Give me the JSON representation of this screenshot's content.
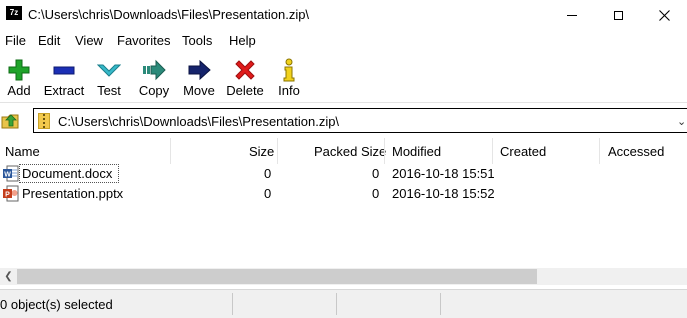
{
  "window": {
    "app_icon_text": "7z",
    "title": "C:\\Users\\chris\\Downloads\\Files\\Presentation.zip\\"
  },
  "menu": [
    "File",
    "Edit",
    "View",
    "Favorites",
    "Tools",
    "Help"
  ],
  "toolbar": {
    "add": "Add",
    "extract": "Extract",
    "test": "Test",
    "copy": "Copy",
    "move": "Move",
    "delete": "Delete",
    "info": "Info"
  },
  "address": {
    "path": "C:\\Users\\chris\\Downloads\\Files\\Presentation.zip\\"
  },
  "columns": {
    "name": "Name",
    "size": "Size",
    "packed_size": "Packed Size",
    "modified": "Modified",
    "created": "Created",
    "accessed": "Accessed"
  },
  "files": [
    {
      "name": "Document.docx",
      "size": "0",
      "packed_size": "0",
      "modified": "2016-10-18 15:51",
      "icon": "word-doc-icon"
    },
    {
      "name": "Presentation.pptx",
      "size": "0",
      "packed_size": "0",
      "modified": "2016-10-18 15:52",
      "icon": "powerpoint-icon"
    }
  ],
  "status": {
    "selected": "0 object(s) selected"
  },
  "colors": {
    "add_green": "#1fa32a",
    "extract_blue": "#1b2fb5",
    "test_teal": "#37b9c9",
    "copy_teal": "#2b8a7a",
    "move_navy": "#15236b",
    "delete_red": "#e01b1b",
    "info_yellow": "#f1d21c"
  }
}
